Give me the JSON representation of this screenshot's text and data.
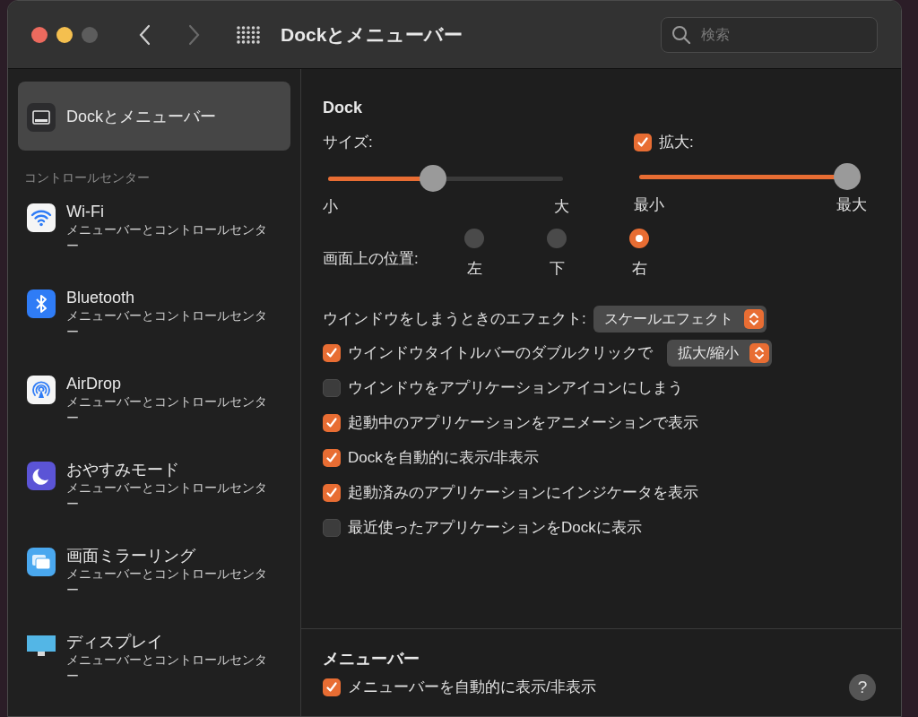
{
  "window": {
    "title": "Dockとメニューバー"
  },
  "toolbar": {
    "search": {
      "placeholder": "検索"
    }
  },
  "sidebar": {
    "items": [
      {
        "kind": "dock",
        "title": "Dockとメニューバー",
        "selected": true
      },
      {
        "kind": "section",
        "title": "コントロールセンター"
      },
      {
        "kind": "wifi",
        "title": "Wi-Fi",
        "subtitle": "メニューバーとコントロールセンター",
        "selected": false
      },
      {
        "kind": "bluetooth",
        "title": "Bluetooth",
        "subtitle": "メニューバーとコントロールセンター",
        "selected": false
      },
      {
        "kind": "airdrop",
        "title": "AirDrop",
        "subtitle": "メニューバーとコントロールセンター",
        "selected": false
      },
      {
        "kind": "moon",
        "title": "おやすみモード",
        "subtitle": "メニューバーとコントロールセンター",
        "selected": false
      },
      {
        "kind": "mirroring",
        "title": "画面ミラーリング",
        "subtitle": "メニューバーとコントロールセンター",
        "selected": false
      },
      {
        "kind": "display",
        "title": "ディスプレイ",
        "subtitle": "メニューバーとコントロールセンター",
        "selected": false
      }
    ]
  },
  "dock": {
    "heading": "Dock",
    "size": {
      "label": "サイズ:",
      "level": 0.44,
      "min": "小",
      "max": "大"
    },
    "magnification": {
      "label": "拡大:",
      "checked": true,
      "level": 1.0,
      "min": "最小",
      "max": "最大"
    },
    "position": {
      "label": "画面上の位置:",
      "options": [
        {
          "label": "左",
          "selected": false
        },
        {
          "label": "下",
          "selected": false
        },
        {
          "label": "右",
          "selected": true
        }
      ]
    },
    "minimize_effect": {
      "label": "ウインドウをしまうときのエフェクト:",
      "value": "スケールエフェクト"
    },
    "options": [
      {
        "kind": "checkbox-select",
        "label": "ウインドウタイトルバーのダブルクリックで",
        "checked": true,
        "value": "拡大/縮小"
      },
      {
        "kind": "checkbox",
        "label": "ウインドウをアプリケーションアイコンにしまう",
        "checked": false
      },
      {
        "kind": "checkbox",
        "label": "起動中のアプリケーションをアニメーションで表示",
        "checked": true
      },
      {
        "kind": "checkbox",
        "label": "Dockを自動的に表示/非表示",
        "checked": true
      },
      {
        "kind": "checkbox",
        "label": "起動済みのアプリケーションにインジケータを表示",
        "checked": true
      },
      {
        "kind": "checkbox",
        "label": "最近使ったアプリケーションをDockに表示",
        "checked": false
      }
    ]
  },
  "menu_bar": {
    "heading": "メニューバー",
    "options": [
      {
        "label": "メニューバーを自動的に表示/非表示",
        "checked": true
      }
    ]
  },
  "help": {
    "label": "?"
  }
}
